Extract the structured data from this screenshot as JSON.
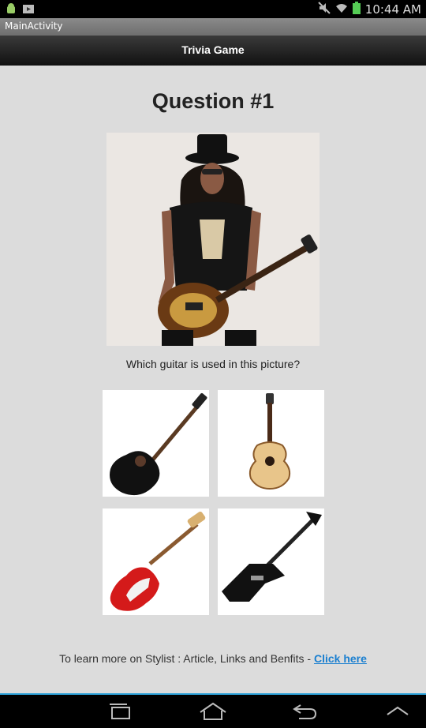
{
  "status_bar": {
    "time": "10:44 AM",
    "icons": [
      "android-debug-icon",
      "media-icon",
      "mute-icon",
      "wifi-icon",
      "battery-icon"
    ]
  },
  "activity_title": "MainActivity",
  "action_bar": {
    "title": "Trivia Game"
  },
  "question": {
    "title": "Question #1",
    "text": "Which guitar is used in this picture?",
    "image": "guitarist-photo"
  },
  "options": [
    {
      "name": "acoustic-cutaway-black"
    },
    {
      "name": "acoustic-natural"
    },
    {
      "name": "electric-red-strat"
    },
    {
      "name": "electric-black-explorer"
    }
  ],
  "footer": {
    "text": "To learn more on Stylist : Article, Links and Benfits - ",
    "link": "Click here"
  },
  "colors": {
    "accent": "#2aa0d8",
    "link": "#1a7fd0",
    "background": "#dcdcdc"
  },
  "nav_bar": {
    "buttons": [
      "recent-apps-icon",
      "home-icon",
      "back-icon",
      "menu-up-icon"
    ]
  }
}
